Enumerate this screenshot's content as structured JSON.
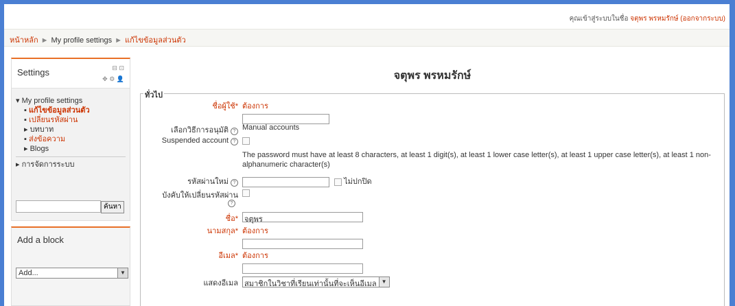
{
  "topbar": {
    "logged_in_prefix": "คุณเข้าสู่ระบบในชื่อ",
    "username": "จตุพร พรหมรักษ์",
    "logout": "(ออกจากระบบ)"
  },
  "breadcrumb": {
    "home": "หน้าหลัก",
    "sep": "►",
    "profile_settings": "My profile settings",
    "edit_profile": "แก้ไขข้อมูลส่วนตัว"
  },
  "settings_block": {
    "title": "Settings",
    "tree": {
      "my_profile_settings": "My profile settings",
      "edit_profile": "แก้ไขข้อมูลส่วนตัว",
      "change_password": "เปลี่ยนรหัสผ่าน",
      "roles": "บทบาท",
      "messages": "ส่งข้อความ",
      "blogs": "Blogs",
      "site_admin": "การจัดการระบบ"
    },
    "search_button": "ค้นหา",
    "search_value": ""
  },
  "add_block": {
    "title": "Add a block",
    "select_value": "Add..."
  },
  "main": {
    "title": "จตุพร พรหมรักษ์",
    "legend": "ทั่วไป",
    "fields": {
      "username_label": "ชื่อผู้ใช้*",
      "username_required": "ต้องการ",
      "auth_label": "เลือกวิธีการอนุมัติ",
      "auth_value": "Manual accounts",
      "suspended_label": "Suspended account",
      "password_note": "The password must have at least 8 characters, at least 1 digit(s), at least 1 lower case letter(s), at least 1 upper case letter(s), at least 1 non-alphanumeric character(s)",
      "newpass_label": "รหัสผ่านใหม่",
      "unmask_label": "ไม่ปกปิด",
      "force_change_label": "บังคับให้เปลี่ยนรหัสผ่าน",
      "firstname_label": "ชื่อ*",
      "firstname_value": "จตุพร",
      "lastname_label": "นามสกุล*",
      "lastname_required": "ต้องการ",
      "email_label": "อีเมล*",
      "email_required": "ต้องการ",
      "showemail_label": "แสดงอีเมล",
      "showemail_value": "สมาชิกในวิชาที่เรียนเท่านั้นที่จะเห็นอีเมล"
    }
  }
}
